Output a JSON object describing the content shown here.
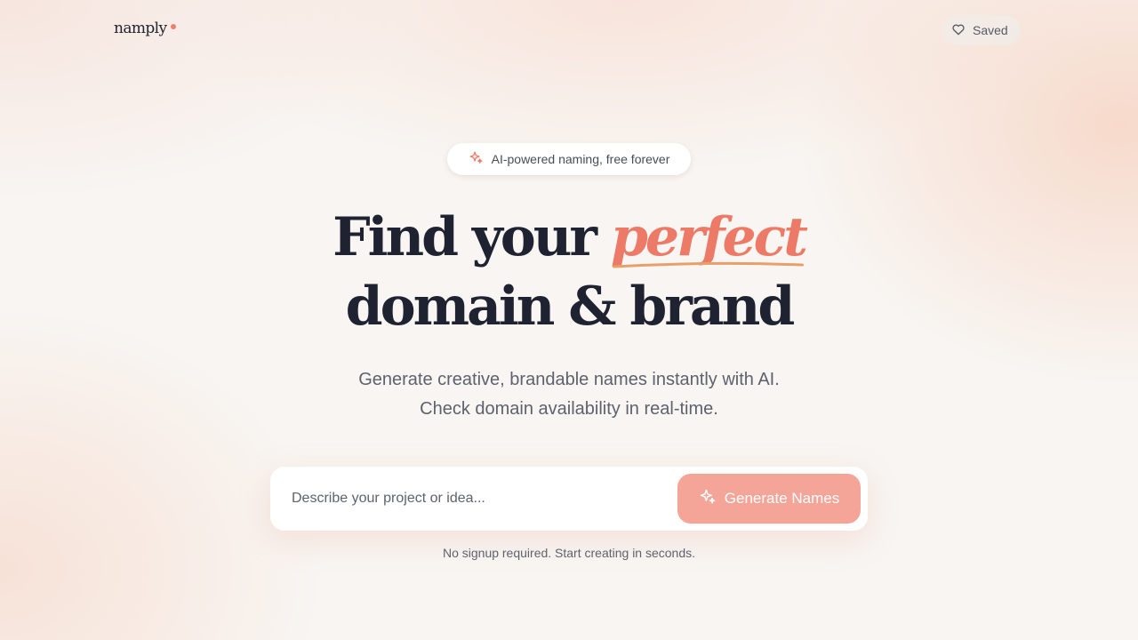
{
  "header": {
    "logo_text": "namply",
    "saved_label": "Saved"
  },
  "badge": {
    "text": "AI-powered naming, free forever"
  },
  "hero": {
    "title_prefix": "Find your",
    "title_accent": "perfect",
    "title_line2": "domain & brand",
    "subtitle_line1": "Generate creative, brandable names instantly with AI.",
    "subtitle_line2": "Check domain availability in real-time."
  },
  "search": {
    "placeholder": "Describe your project or idea...",
    "value": "",
    "button_label": "Generate Names"
  },
  "footer_note": "No signup required. Start creating in seconds.",
  "icons": {
    "saved": "heart-icon",
    "badge": "sparkles-icon",
    "button": "sparkles-icon"
  },
  "colors": {
    "accent": "#ec7a66",
    "button": "#f4a597",
    "text": "#1f2230",
    "muted": "#5e626d"
  }
}
